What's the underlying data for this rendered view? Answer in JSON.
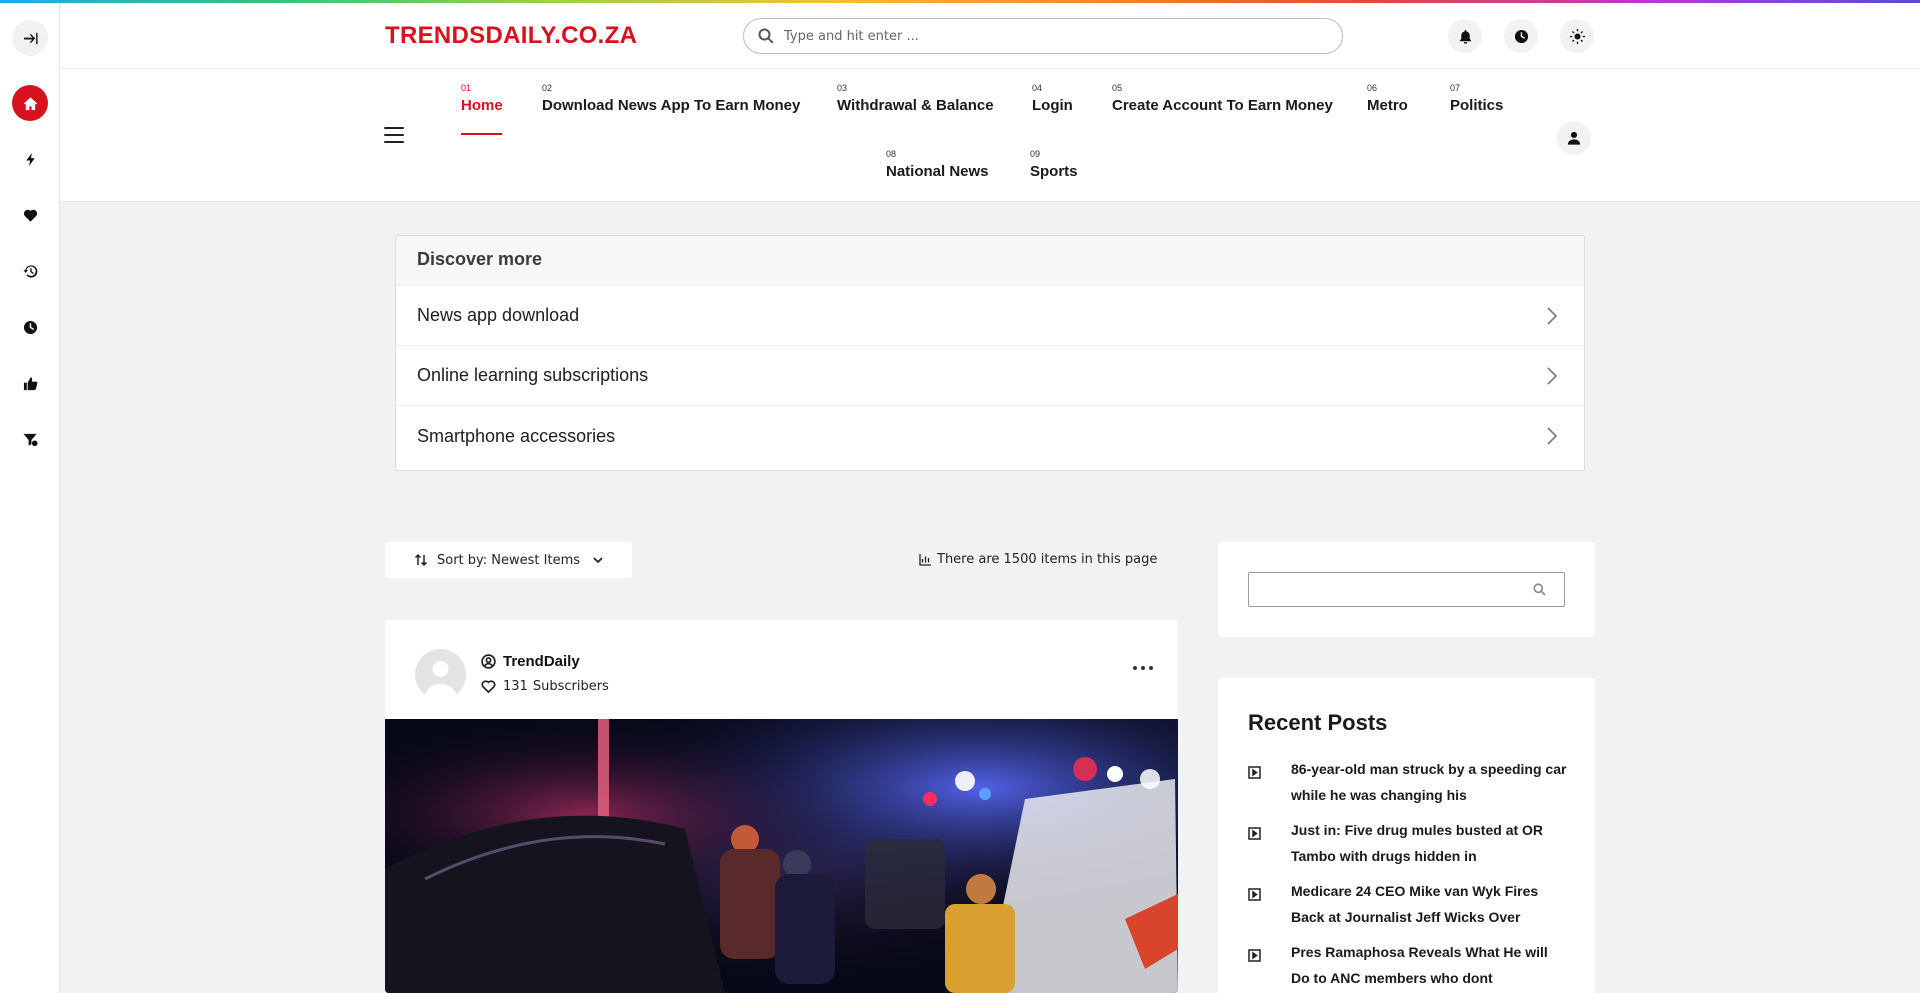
{
  "brand": {
    "logo": "TRENDSDAILY.CO.ZA",
    "accent": "#d6121f"
  },
  "search": {
    "placeholder": "Type and hit enter ..."
  },
  "rail": {
    "items": [
      "exit-toggle-icon",
      "home-icon",
      "bolt-icon",
      "heart-icon",
      "history-icon",
      "clock-icon",
      "thumbs-up-icon",
      "filter-icon"
    ]
  },
  "header_icons": [
    "bell-icon",
    "clock-icon",
    "sun-icon"
  ],
  "nav": {
    "items": [
      {
        "num": "01",
        "label": "Home"
      },
      {
        "num": "02",
        "label": "Download News App To Earn Money"
      },
      {
        "num": "03",
        "label": "Withdrawal & Balance"
      },
      {
        "num": "04",
        "label": "Login"
      },
      {
        "num": "05",
        "label": "Create Account To Earn Money"
      },
      {
        "num": "06",
        "label": "Metro"
      },
      {
        "num": "07",
        "label": "Politics"
      },
      {
        "num": "08",
        "label": "National News"
      },
      {
        "num": "09",
        "label": "Sports"
      }
    ],
    "active": "Home"
  },
  "discover": {
    "title": "Discover more",
    "items": [
      "News app download",
      "Online learning subscriptions",
      "Smartphone accessories"
    ]
  },
  "listing": {
    "sort_label": "Sort by: Newest Items",
    "count_text": "There are 1500 items in this page"
  },
  "post": {
    "author": "TrendDaily",
    "subscribers_count": "131",
    "subscribers_label": "Subscribers"
  },
  "sidebar": {
    "recent_title": "Recent Posts",
    "recent_posts": [
      "86-year-old man struck by a speeding car while he was changing his",
      "Just in: Five drug mules busted at OR Tambo with drugs hidden in",
      "Medicare 24 CEO Mike van Wyk Fires Back at Journalist Jeff Wicks Over",
      "Pres Ramaphosa Reveals What He will Do to ANC members who dont"
    ]
  }
}
